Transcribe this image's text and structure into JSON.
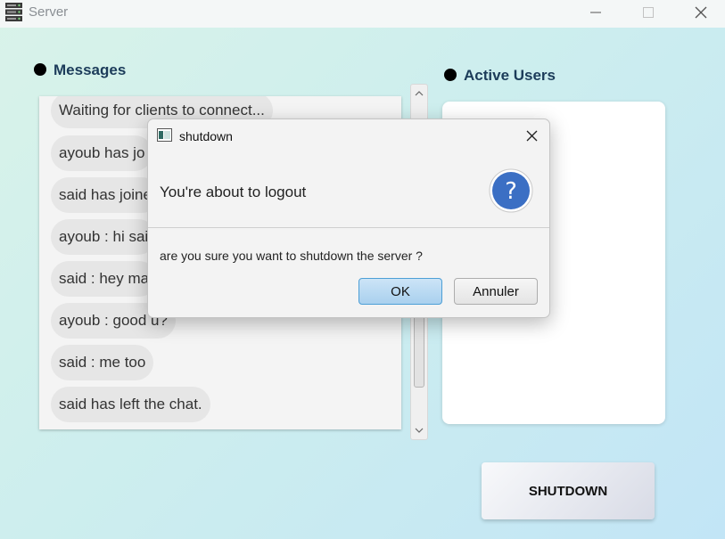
{
  "window": {
    "title": "Server"
  },
  "messages_section": {
    "heading": "Messages",
    "items": [
      "Waiting for clients to connect...",
      "ayoub has jo",
      "said has joine",
      "ayoub : hi sai",
      "said : hey ma",
      "ayoub : good u?",
      "said : me too",
      "said has left the chat."
    ]
  },
  "users_section": {
    "heading": "Active Users"
  },
  "shutdown_label": "SHUTDOWN",
  "dialog": {
    "title": "shutdown",
    "header": "You're about to logout",
    "content": "are you sure you want to shutdown the server ?",
    "ok_label": "OK",
    "cancel_label": "Annuler"
  },
  "colors": {
    "heading": "#1c3c5a",
    "accent": "#3b6fc4",
    "ok_border": "#4d9fd6"
  },
  "icons": [
    "server-icon",
    "minimize-icon",
    "maximize-icon",
    "close-icon",
    "window-icon",
    "question-icon",
    "chevron-up-icon",
    "chevron-down-icon"
  ]
}
